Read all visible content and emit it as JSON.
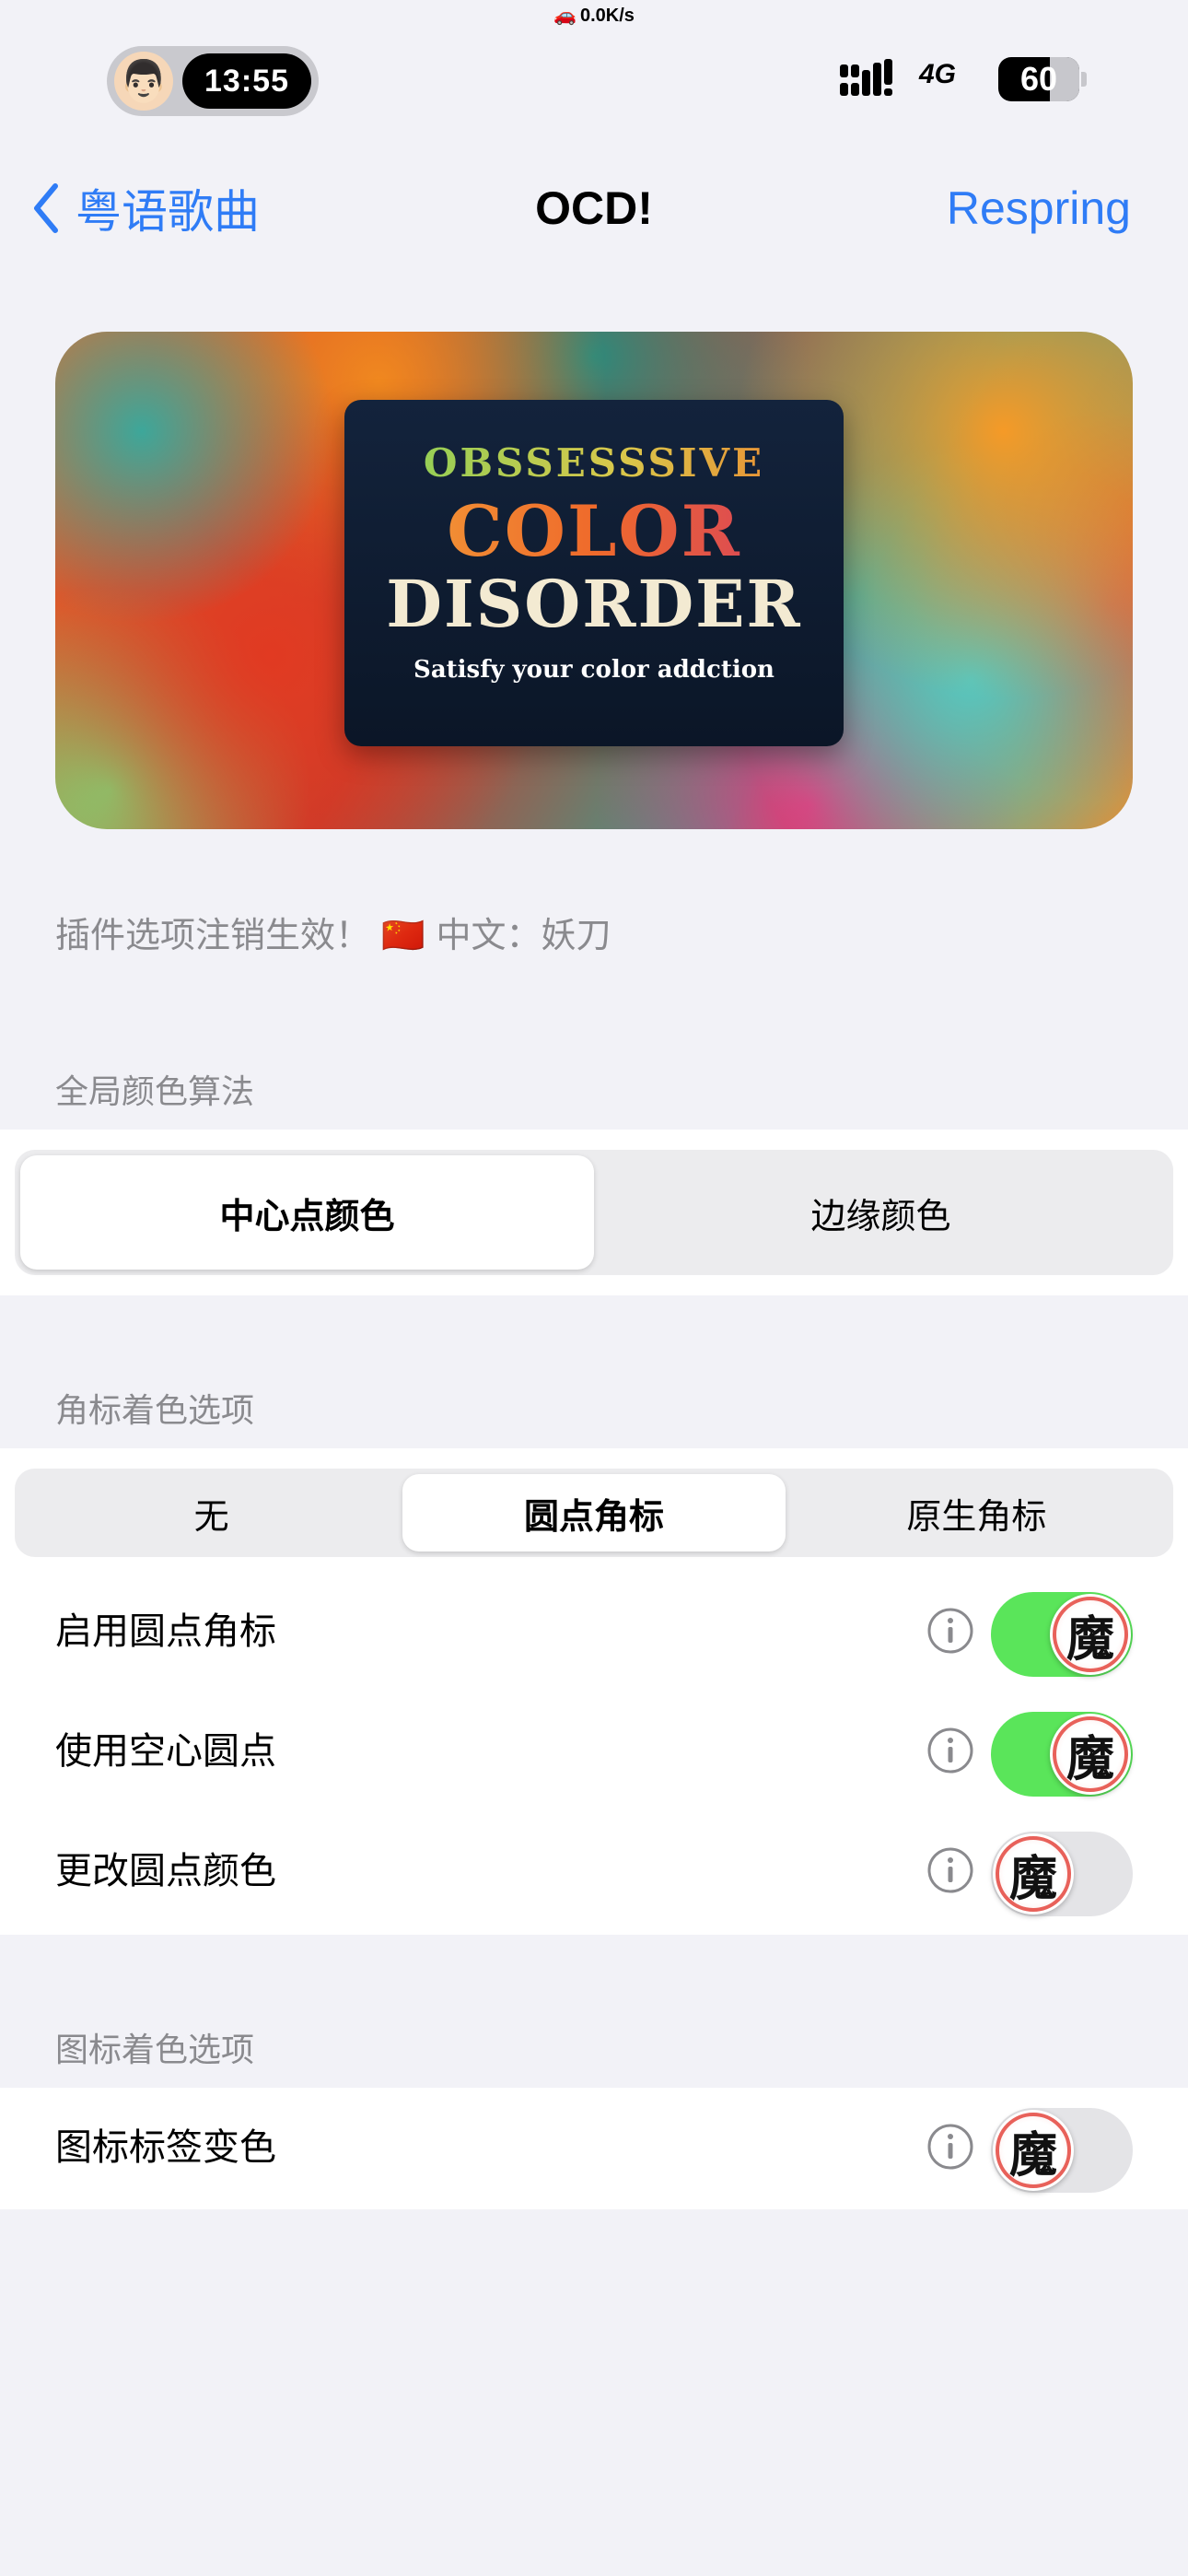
{
  "status_bar": {
    "net_speed": "0.0K/s",
    "time": "13:55",
    "network": "4G",
    "battery": "60",
    "battery_level": 0.6
  },
  "nav": {
    "back_label": "粤语歌曲",
    "title": "OCD!",
    "action_label": "Respring"
  },
  "banner": {
    "line1": "OBSSESSSIVE",
    "line2": "COLOR",
    "line3": "DISORDER",
    "line4": "Satisfy your color addction"
  },
  "note": "插件选项注销生效！ 🇨🇳 中文：妖刀",
  "sections": {
    "global_color": {
      "header": "全局颜色算法",
      "options": [
        "中心点颜色",
        "边缘颜色"
      ],
      "selected": 0
    },
    "badge_color": {
      "header": "角标着色选项",
      "options": [
        "无",
        "圆点角标",
        "原生角标"
      ],
      "selected": 1,
      "rows": [
        {
          "label": "启用圆点角标",
          "on": true
        },
        {
          "label": "使用空心圆点",
          "on": true
        },
        {
          "label": "更改圆点颜色",
          "on": false
        }
      ]
    },
    "icon_color": {
      "header": "图标着色选项",
      "rows": [
        {
          "label": "图标标签变色",
          "on": false
        }
      ]
    }
  },
  "toggle_knob_glyph": "魔",
  "colors": {
    "accent": "#2f7cf6",
    "toggle_on": "#5ae55a",
    "background": "#f2f2f7"
  }
}
